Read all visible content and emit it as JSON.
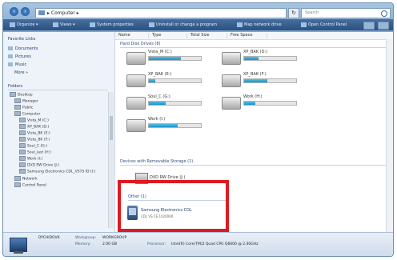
{
  "address": {
    "crumb": "▸ Computer ▸"
  },
  "search": {
    "placeholder": "Search"
  },
  "toolbar": {
    "items": [
      "Organize ▾",
      "Views ▾",
      "System properties",
      "Uninstall or change a program",
      "Map network drive",
      "Open Control Panel"
    ]
  },
  "favorites": [
    {
      "label": "Favorite Links",
      "icon": "star-icon"
    },
    {
      "label": "Documents",
      "icon": "folder-icon"
    },
    {
      "label": "Pictures",
      "icon": "folder-icon"
    },
    {
      "label": "Music",
      "icon": "folder-icon"
    },
    {
      "label": "More »",
      "icon": ""
    }
  ],
  "folders_label": "Folders",
  "tree": [
    "Desktop",
    "Manager",
    "Public",
    "Computer",
    "Vista_M (C:)",
    "XP_BAK (D:)",
    "Vista_BK (E:)",
    "Vista_BK (F:)",
    "Soul_C (G:)",
    "Soul_last (H:)",
    "Work (I:)",
    "DVD RW Drive (J:)",
    "Samsung Electronics CDL_VS75 ID (I:)",
    "Network",
    "Control Panel"
  ],
  "columns": [
    "Name",
    "Type",
    "Total Size",
    "Free Space"
  ],
  "groups": {
    "hdd": "Hard Disk Drives (8)",
    "removable": "Devices with Removable Storage (1)",
    "other": "Other (1)"
  },
  "drives": [
    {
      "name": "Vista_M (C:)",
      "free": "",
      "fill": 0.62
    },
    {
      "name": "XP_BAK (D:)",
      "free": "",
      "fill": 0.28
    },
    {
      "name": "XP_BAK (E:)",
      "free": "",
      "fill": 0.12
    },
    {
      "name": "XP_BAK (F:)",
      "free": "",
      "fill": 0.45
    },
    {
      "name": "Soul_C (G:)",
      "free": "",
      "fill": 0.33
    },
    {
      "name": "Work (H:)",
      "free": "",
      "fill": 0.22
    },
    {
      "name": "Work (I:)",
      "free": "",
      "fill": 0.55
    }
  ],
  "dvd": {
    "name": "DVD RW Drive (J:)"
  },
  "device": {
    "name": "Samsung Electronics CDL",
    "sub": "CDL VS CE 1020000"
  },
  "details": {
    "workgroup_label": "Workgroup:",
    "workgroup": "WORKGROUP",
    "processor_label": "Processor:",
    "processor": "Intel(R) Core(TM)2 Quad CPU  Q6600 @ 2.40GHz",
    "memory_label": "Memory:",
    "memory": "2.00 GB",
    "name": "DYCHIDOVK"
  }
}
